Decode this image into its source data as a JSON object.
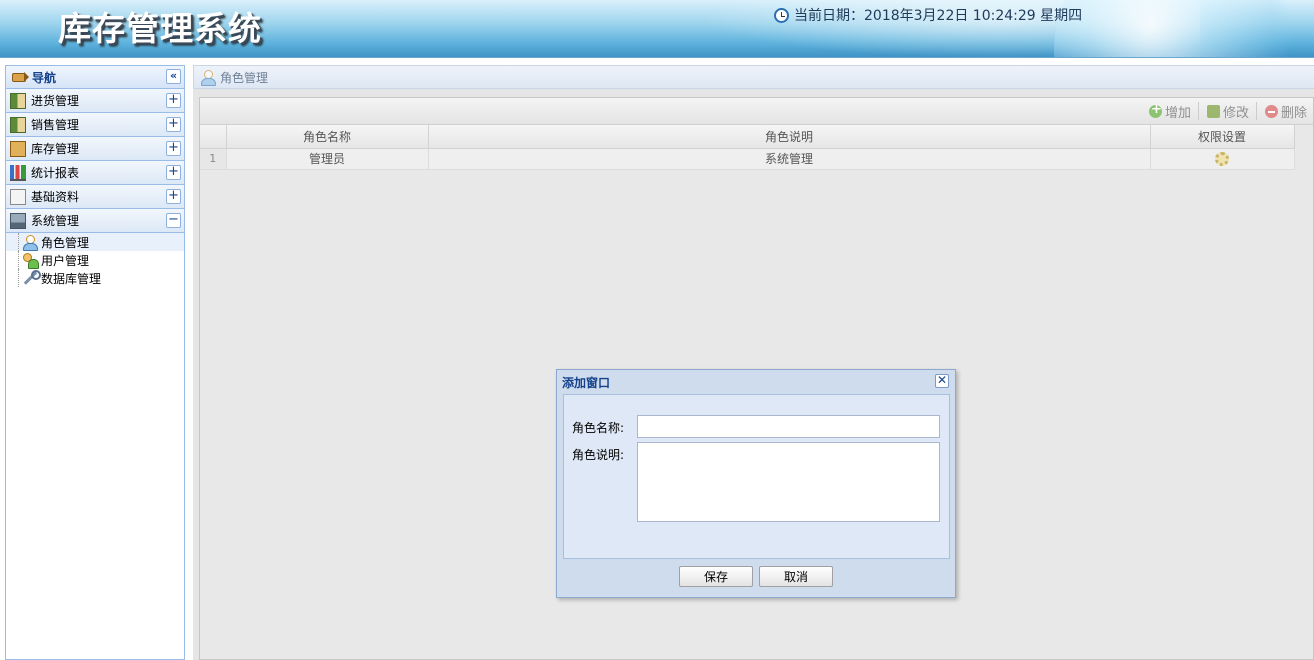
{
  "header": {
    "app_title": "库存管理系统",
    "date_text": "当前日期：2018年3月22日 10:24:29 星期四"
  },
  "nav": {
    "title": "导航",
    "collapse_symbol": "«",
    "sections": [
      {
        "label": "进货管理",
        "toggle": "+",
        "icon": "goods-icon"
      },
      {
        "label": "销售管理",
        "toggle": "+",
        "icon": "goods-icon"
      },
      {
        "label": "库存管理",
        "toggle": "+",
        "icon": "stock-icon"
      },
      {
        "label": "统计报表",
        "toggle": "+",
        "icon": "chart-icon"
      },
      {
        "label": "基础资料",
        "toggle": "+",
        "icon": "doc-icon"
      },
      {
        "label": "系统管理",
        "toggle": "−",
        "icon": "system-icon"
      }
    ],
    "system_items": [
      {
        "label": "角色管理",
        "icon": "user-icon",
        "selected": true
      },
      {
        "label": "用户管理",
        "icon": "users-icon",
        "selected": false
      },
      {
        "label": "数据库管理",
        "icon": "wrench-icon",
        "selected": false
      }
    ]
  },
  "main": {
    "tab_title": "角色管理",
    "toolbar": {
      "add_label": "增加",
      "edit_label": "修改",
      "delete_label": "删除"
    },
    "table": {
      "columns": [
        "角色名称",
        "角色说明",
        "权限设置"
      ],
      "rows": [
        {
          "num": "1",
          "name": "管理员",
          "desc": "系统管理"
        }
      ]
    }
  },
  "dialog": {
    "title": "添加窗口",
    "close_symbol": "✕",
    "name_label": "角色名称:",
    "name_value": "",
    "desc_label": "角色说明:",
    "desc_value": "",
    "save_label": "保存",
    "cancel_label": "取消"
  },
  "colors": {
    "accent": "#15428b",
    "nav_border": "#99bbe8",
    "dialog_bg": "#cfdcee"
  }
}
